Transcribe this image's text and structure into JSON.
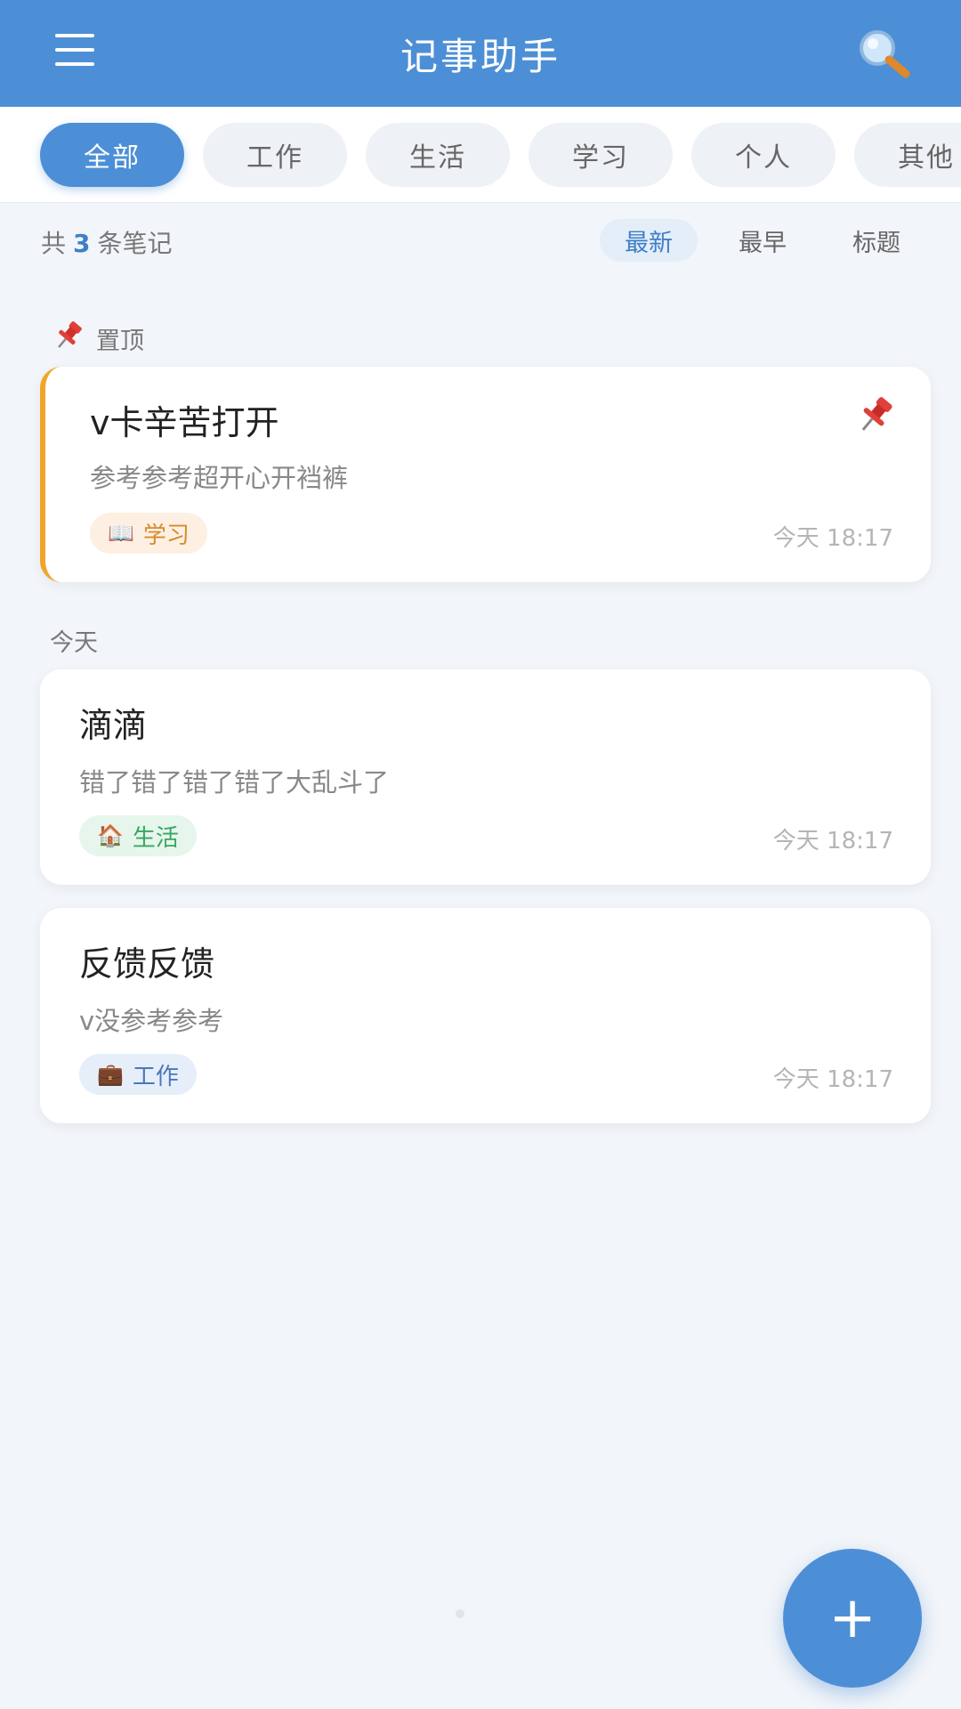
{
  "header": {
    "title": "记事助手",
    "menu_icon": "menu-icon",
    "search_icon": "search-icon"
  },
  "categories": [
    {
      "label": "全部",
      "active": true
    },
    {
      "label": "工作",
      "active": false
    },
    {
      "label": "生活",
      "active": false
    },
    {
      "label": "学习",
      "active": false
    },
    {
      "label": "个人",
      "active": false
    },
    {
      "label": "其他",
      "active": false
    }
  ],
  "summary": {
    "prefix": "共",
    "count": "3",
    "suffix": "条笔记"
  },
  "sort_options": [
    {
      "label": "最新",
      "active": true
    },
    {
      "label": "最早",
      "active": false
    },
    {
      "label": "标题",
      "active": false
    }
  ],
  "pinned_section": {
    "label": "置顶",
    "icon": "pushpin-icon"
  },
  "today_section": {
    "label": "今天"
  },
  "notes": [
    {
      "title": "v卡辛苦打开",
      "body": "参考参考超开心开裆裤",
      "tag": "学习",
      "tag_icon": "book-icon",
      "time": "今天 18:17",
      "pinned": true
    },
    {
      "title": "滴滴",
      "body": "错了错了错了错了大乱斗了",
      "tag": "生活",
      "tag_icon": "house-icon",
      "time": "今天 18:17",
      "pinned": false
    },
    {
      "title": "反馈反馈",
      "body": "v没参考参考",
      "tag": "工作",
      "tag_icon": "briefcase-icon",
      "time": "今天 18:17",
      "pinned": false
    }
  ],
  "fab": {
    "icon": "plus-icon",
    "symbol": "+"
  },
  "colors": {
    "primary": "#4d8fd6",
    "pinned_accent": "#f0a52a",
    "background": "#f2f5f9"
  }
}
